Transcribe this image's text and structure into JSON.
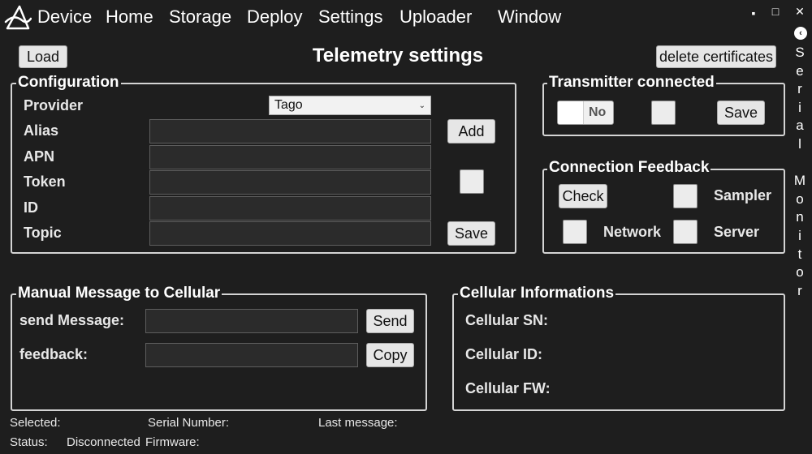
{
  "menu": {
    "items": [
      "Device",
      "Home",
      "Storage",
      "Deploy",
      "Settings",
      "Uploader",
      "Window"
    ]
  },
  "window_controls": {
    "minimize": "▪",
    "maximize": "□",
    "close": "✕"
  },
  "side_panel": {
    "collapse_glyph": "‹",
    "label_letters": [
      "S",
      "e",
      "r",
      "i",
      "a",
      "l",
      "",
      "M",
      "o",
      "n",
      "i",
      "t",
      "o",
      "r"
    ]
  },
  "toolbar": {
    "load_label": "Load",
    "delete_certificates_label": "delete certificates"
  },
  "page_title": "Telemetry settings",
  "configuration": {
    "legend": "Configuration",
    "provider_label": "Provider",
    "provider_selected": "Tago",
    "alias_label": "Alias",
    "alias_value": "",
    "apn_label": "APN",
    "apn_value": "",
    "token_label": "Token",
    "token_value": "",
    "id_label": "ID",
    "id_value": "",
    "topic_label": "Topic",
    "topic_value": "",
    "add_label": "Add",
    "save_label": "Save"
  },
  "transmitter": {
    "legend": "Transmitter connected",
    "toggle_label": "No",
    "save_label": "Save"
  },
  "connection_feedback": {
    "legend": "Connection Feedback",
    "check_label": "Check",
    "sampler_label": "Sampler",
    "network_label": "Network",
    "server_label": "Server"
  },
  "manual_message": {
    "legend": "Manual Message to Cellular",
    "send_message_label": "send Message:",
    "send_message_value": "",
    "feedback_label": "feedback:",
    "feedback_value": "",
    "send_label": "Send",
    "copy_label": "Copy"
  },
  "cellular_info": {
    "legend": "Cellular Informations",
    "sn_label": "Cellular SN:",
    "id_label": "Cellular ID:",
    "fw_label": "Cellular FW:"
  },
  "status_bar": {
    "selected_label": "Selected:",
    "serial_number_label": "Serial Number:",
    "last_message_label": "Last message:",
    "status_label": "Status:",
    "status_value": "Disconnected",
    "firmware_label": "Firmware:"
  }
}
